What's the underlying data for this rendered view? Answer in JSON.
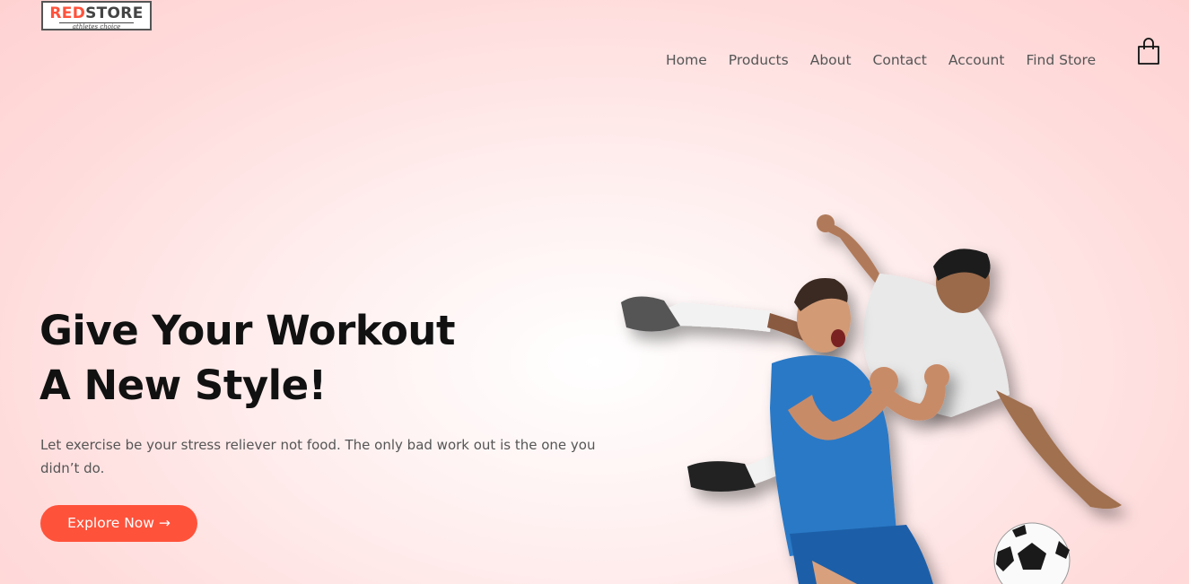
{
  "brand": {
    "logo_part1": "RED",
    "logo_part2": "STORE",
    "logo_tagline": "athletes choice",
    "accent_color": "#ff523b"
  },
  "nav": {
    "items": [
      "Home",
      "Products",
      "About",
      "Contact",
      "Account",
      "Find Store"
    ],
    "cart_icon": "shopping-bag-icon"
  },
  "hero": {
    "title_line1": "Give Your Workout",
    "title_line2": "A New Style!",
    "text": "Let exercise be your stress reliever not food. The only bad work out is the one you didn’t do.",
    "button_label": "Explore Now →",
    "image": "soccer-players-photo"
  }
}
